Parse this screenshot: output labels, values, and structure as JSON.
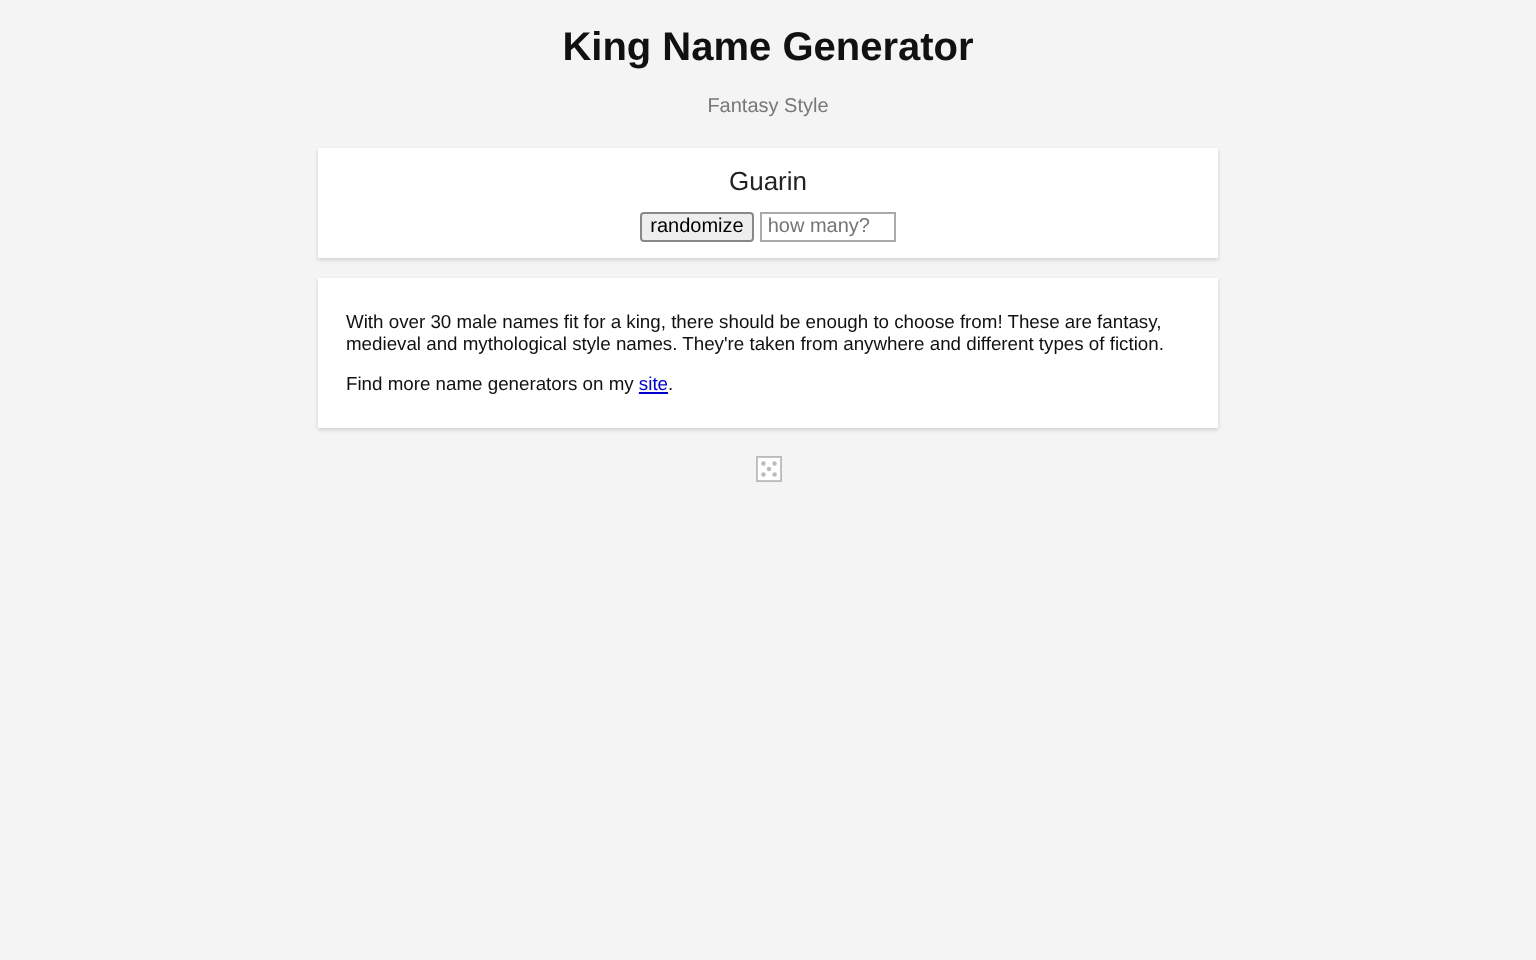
{
  "header": {
    "title": "King Name Generator",
    "subtitle": "Fantasy Style"
  },
  "generator": {
    "result": "Guarin",
    "button": "randomize",
    "count_field": {
      "placeholder": "how many?"
    }
  },
  "info": {
    "description": "With over 30 male names fit for a king, there should be enough to choose from! These are fantasy, medieval and mythological style names. They're taken from anywhere and different types of fiction.",
    "more": {
      "before": "Find more name generators on my ",
      "link": "site",
      "after": "."
    }
  }
}
